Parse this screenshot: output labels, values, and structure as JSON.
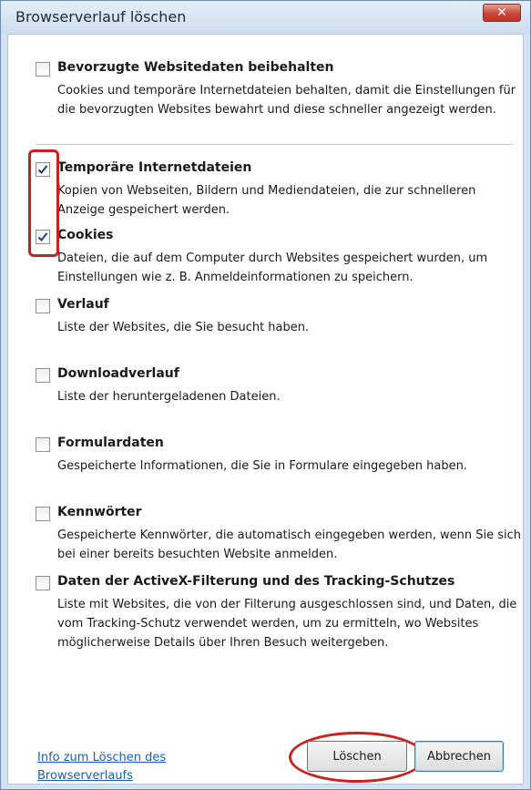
{
  "window": {
    "title": "Browserverlauf löschen",
    "close_glyph": "✕"
  },
  "options": [
    {
      "title": "Bevorzugte Websitedaten beibehalten",
      "description": "Cookies und temporäre Internetdateien behalten, damit die Einstellungen für die bevorzugten Websites bewahrt und diese schneller angezeigt werden.",
      "checked": false
    },
    {
      "title": "Temporäre Internetdateien",
      "description": "Kopien von Webseiten, Bildern und Mediendateien, die zur schnelleren Anzeige gespeichert werden.",
      "checked": true
    },
    {
      "title": "Cookies",
      "description": "Dateien, die auf dem Computer durch Websites gespeichert wurden, um Einstellungen wie z. B. Anmeldeinformationen zu speichern.",
      "checked": true
    },
    {
      "title": "Verlauf",
      "description": "Liste der Websites, die Sie besucht haben.",
      "checked": false
    },
    {
      "title": "Downloadverlauf",
      "description": "Liste der heruntergeladenen Dateien.",
      "checked": false
    },
    {
      "title": "Formulardaten",
      "description": "Gespeicherte Informationen, die Sie in Formulare eingegeben haben.",
      "checked": false
    },
    {
      "title": "Kennwörter",
      "description": "Gespeicherte Kennwörter, die automatisch eingegeben werden, wenn Sie sich bei einer bereits besuchten Website anmelden.",
      "checked": false
    },
    {
      "title": "Daten der ActiveX-Filterung und des Tracking-Schutzes",
      "description": "Liste mit Websites, die von der Filterung ausgeschlossen sind, und Daten, die vom Tracking-Schutz verwendet werden, um zu ermitteln, wo Websites möglicherweise Details über Ihren Besuch weitergeben.",
      "checked": false
    }
  ],
  "footer": {
    "info_link": "Info zum Löschen des Browserverlaufs",
    "delete_label": "Löschen",
    "cancel_label": "Abbrechen"
  },
  "colors": {
    "annotation": "#cc1f1f",
    "link": "#1a5fb4",
    "close_button": "#c9463a"
  },
  "icons": {
    "check": "checkmark-icon",
    "close": "close-icon"
  }
}
